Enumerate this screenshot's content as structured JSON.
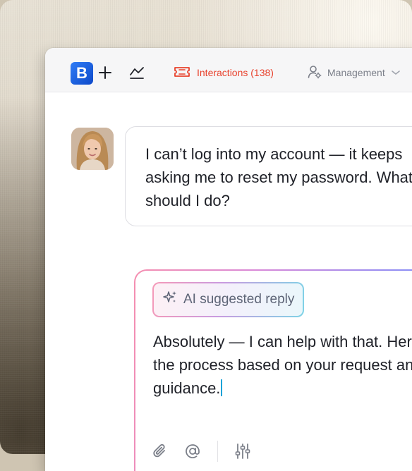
{
  "colors": {
    "brand": "#1558e0",
    "accent_red": "#e8412c",
    "muted": "#7b7f89",
    "ai_gradient": [
      "#f58fb0",
      "#9a8cf0",
      "#6f95ff"
    ]
  },
  "topbar": {
    "logo_letter": "B",
    "icons": [
      "plus-icon",
      "chart-icon"
    ],
    "tabs": [
      {
        "label": "Interactions (138)",
        "icon": "ticket-icon",
        "active": true
      },
      {
        "label": "Management",
        "icon": "user-settings-icon",
        "dropdown": true
      }
    ]
  },
  "conversation": {
    "customer_message": "I can’t log into my account — it keeps asking me to reset my password. What should I do?"
  },
  "reply_box": {
    "ai_chip_label": "AI suggested reply",
    "ai_chip_icon": "sparkles-icon",
    "draft_text": "Absolutely — I can help with that. Here’s the process based on your request and guidance.",
    "toolbar_icons": [
      "paperclip-icon",
      "at-icon",
      "sliders-icon"
    ]
  }
}
